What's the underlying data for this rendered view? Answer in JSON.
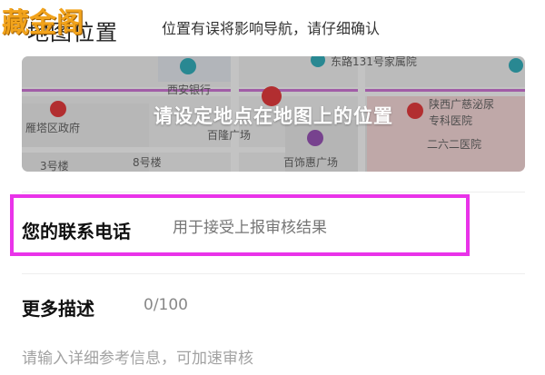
{
  "header": {
    "logo_text": "藏金阁",
    "title": "地图位置",
    "hint": "位置有误将影响导航，请仔细确认"
  },
  "map": {
    "overlay_text": "请设定地点在地图上的位置",
    "labels": {
      "street": "东路131号家属院",
      "bank": "西安银行",
      "district": "雁塔区政府",
      "plaza": "百隆广场",
      "mall": "百饰惠广场",
      "building3": "3号楼",
      "building8": "8号楼",
      "hospital_a": "陕西广慈泌尿",
      "hospital_b": "专科医院",
      "hospital_c": "二六二医院"
    },
    "colors": {
      "marker": "#e0292b",
      "bank_pin": "#22a6b3",
      "mall_pin": "#8e44ad",
      "road_magenta": "#c86ad0"
    }
  },
  "phone": {
    "label": "您的联系电话",
    "placeholder": "用于接受上报审核结果"
  },
  "description": {
    "label": "更多描述",
    "count": "0/100",
    "placeholder": "请输入详细参考信息，可加速审核"
  },
  "highlight_color": "#e933e9"
}
